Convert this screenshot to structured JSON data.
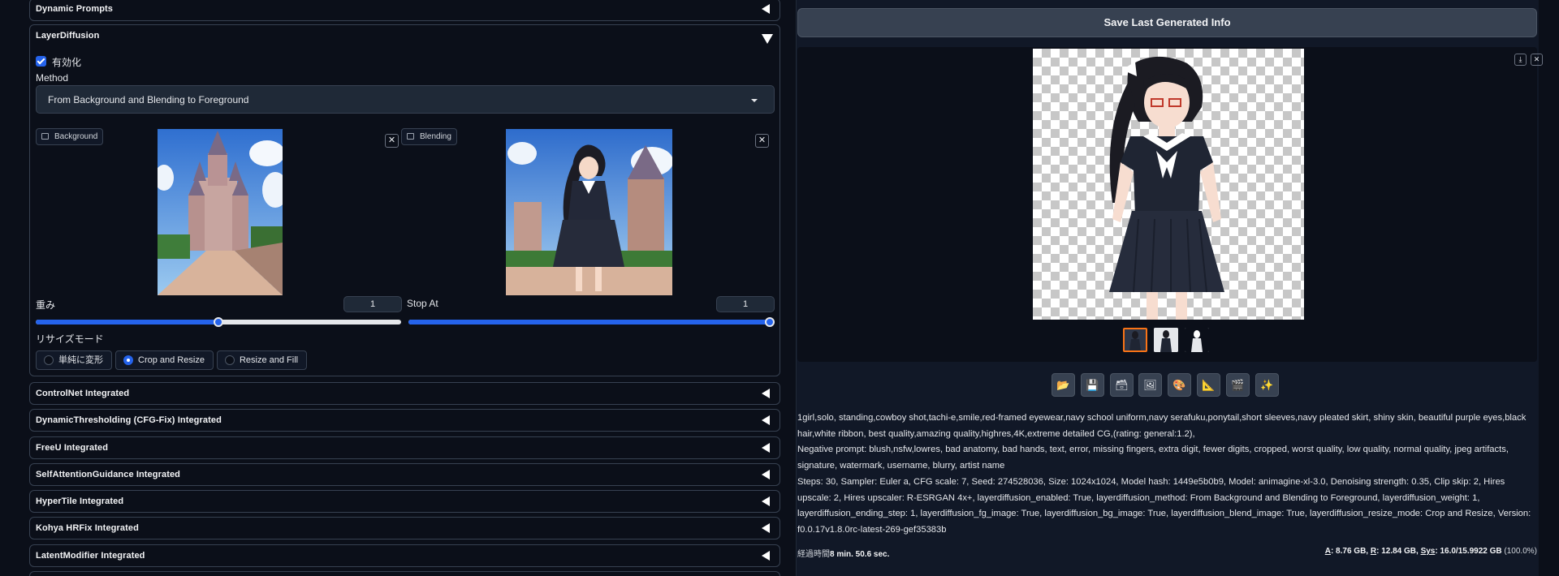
{
  "left": {
    "accordions_top": [
      {
        "title": "Dynamic Prompts"
      }
    ],
    "layer_diffusion": {
      "title": "LayerDiffusion",
      "enable_label": "有効化",
      "enabled": true,
      "method_label": "Method",
      "method_value": "From Background and Blending to Foreground",
      "bg_image_label": "Background",
      "blend_image_label": "Blending",
      "close_symbol": "✕",
      "weight_label": "重み",
      "weight_value": "1",
      "weight_fraction": 0.5,
      "stop_at_label": "Stop At",
      "stop_at_value": "1",
      "stop_at_fraction": 1.0,
      "resize_mode_label": "リサイズモード",
      "resize_options": [
        {
          "label": "単純に変形",
          "selected": false
        },
        {
          "label": "Crop and Resize",
          "selected": true
        },
        {
          "label": "Resize and Fill",
          "selected": false
        }
      ]
    },
    "accordions_bottom": [
      {
        "title": "ControlNet Integrated"
      },
      {
        "title": "DynamicThresholding (CFG-Fix) Integrated"
      },
      {
        "title": "FreeU Integrated"
      },
      {
        "title": "SelfAttentionGuidance Integrated"
      },
      {
        "title": "HyperTile Integrated"
      },
      {
        "title": "Kohya HRFix Integrated"
      },
      {
        "title": "LatentModifier Integrated"
      }
    ]
  },
  "right": {
    "save_button_label": "Save Last Generated Info",
    "gallery": {
      "download_symbol": "⤓",
      "close_symbol": "✕",
      "thumbnail_count": 3,
      "selected_thumbnail": 0
    },
    "tool_icons": [
      "folder-icon",
      "save-icon",
      "zip-icon",
      "image-icon",
      "palette-icon",
      "ruler-icon",
      "film-icon",
      "sparkle-icon"
    ],
    "info_lines": [
      "1girl,solo, standing,cowboy shot,tachi-e,smile,red-framed eyewear,navy school uniform,navy serafuku,ponytail,short sleeves,navy pleated skirt, shiny skin, beautiful purple eyes,black hair,white ribbon, best quality,amazing quality,highres,4K,extreme detailed CG,(rating: general:1.2),",
      "Negative prompt: blush,nsfw,lowres, bad anatomy, bad hands, text, error, missing fingers, extra digit, fewer digits, cropped, worst quality, low quality, normal quality, jpeg artifacts, signature, watermark, username, blurry, artist name",
      "Steps: 30, Sampler: Euler a, CFG scale: 7, Seed: 274528036, Size: 1024x1024, Model hash: 1449e5b0b9, Model: animagine-xl-3.0, Denoising strength: 0.35, Clip skip: 2, Hires upscale: 2, Hires upscaler: R-ESRGAN 4x+, layerdiffusion_enabled: True, layerdiffusion_method: From Background and Blending to Foreground, layerdiffusion_weight: 1, layerdiffusion_ending_step: 1, layerdiffusion_fg_image: True, layerdiffusion_bg_image: True, layerdiffusion_blend_image: True, layerdiffusion_resize_mode: Crop and Resize, Version: f0.0.17v1.8.0rc-latest-269-gef35383b"
    ],
    "footer": {
      "elapsed_label": "経過時間",
      "elapsed_value": "8 min. 50.6 sec.",
      "a_label": "A",
      "a_value": ": 8.76 GB, ",
      "r_label": "R",
      "r_value": ": 12.84 GB, ",
      "sys_label": "Sys",
      "sys_value": ": 16.0/15.9922 GB",
      "sys_pct": " (100.0%)"
    }
  }
}
